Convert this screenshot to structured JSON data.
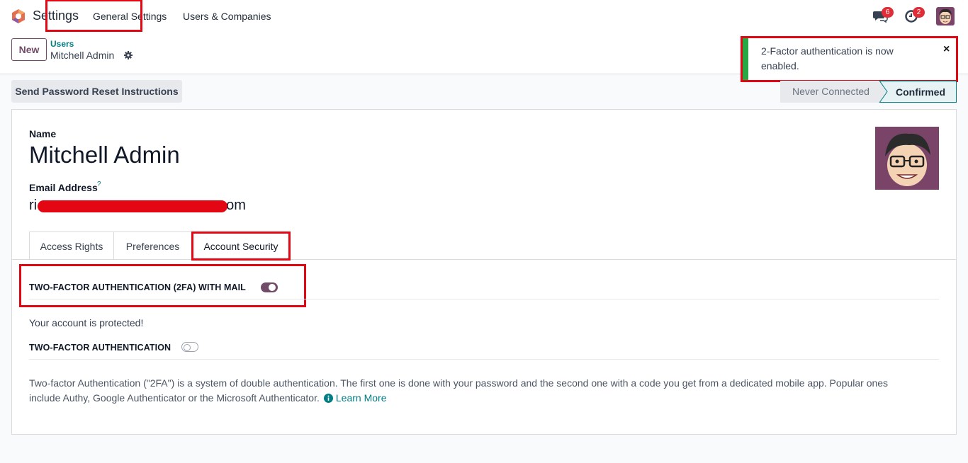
{
  "navbar": {
    "app_name": "Settings",
    "menu": [
      "General Settings",
      "Users & Companies"
    ],
    "chat_count": "6",
    "activity_count": "2"
  },
  "control_panel": {
    "new_label": "New",
    "breadcrumb_parent": "Users",
    "breadcrumb_current": "Mitchell Admin"
  },
  "toast": {
    "message": "2-Factor authentication is now enabled.",
    "close": "×"
  },
  "statusbar": {
    "reset_label": "Send Password Reset Instructions",
    "stages": [
      "Never Connected",
      "Confirmed"
    ],
    "active_stage": "Confirmed"
  },
  "form": {
    "name_label": "Name",
    "name_value": "Mitchell Admin",
    "email_label": "Email Address",
    "email_help": "?",
    "email_prefix": "ri",
    "email_suffix": "com",
    "tabs": [
      "Access Rights",
      "Preferences",
      "Account Security"
    ],
    "active_tab": "Account Security"
  },
  "security": {
    "mail_2fa_label": "TWO-FACTOR AUTHENTICATION (2FA) WITH MAIL",
    "mail_2fa_enabled": true,
    "protected_text": "Your account is protected!",
    "tfa_label": "TWO-FACTOR AUTHENTICATION",
    "tfa_enabled": false,
    "description": "Two-factor Authentication (\"2FA\") is a system of double authentication. The first one is done with your password and the second one with a code you get from a dedicated mobile app. Popular ones include Authy, Google Authenticator or the Microsoft Authenticator.",
    "learn_more": "Learn More"
  },
  "colors": {
    "brand": "#714b67",
    "link": "#017e84",
    "success": "#28a745",
    "annotation": "#e30613"
  }
}
